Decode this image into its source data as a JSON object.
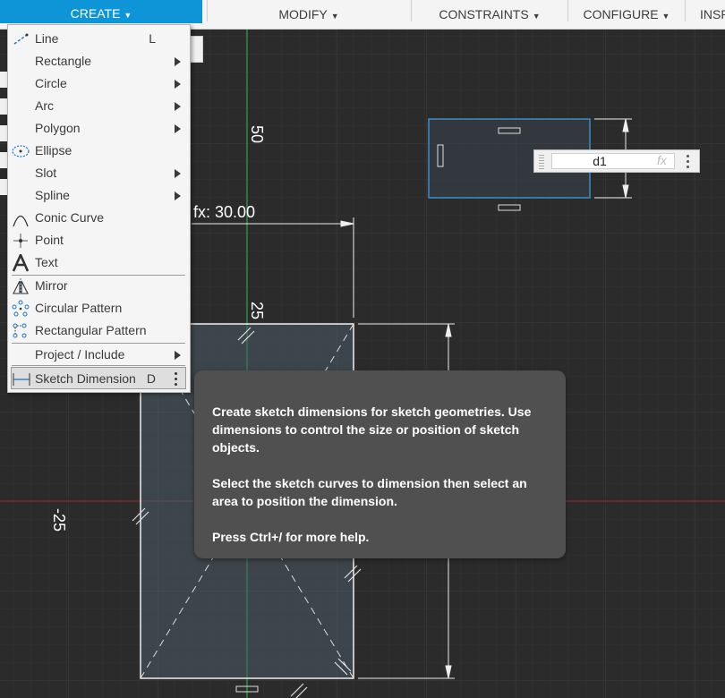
{
  "toolbar": {
    "create": "CREATE",
    "modify": "MODIFY",
    "constraints": "CONSTRAINTS",
    "configure": "CONFIGURE",
    "inspect": "INSPE"
  },
  "menu": {
    "items": [
      {
        "label": "Line",
        "shortcut": "L",
        "icon": "line-icon"
      },
      {
        "label": "Rectangle",
        "submenu": true
      },
      {
        "label": "Circle",
        "submenu": true
      },
      {
        "label": "Arc",
        "submenu": true
      },
      {
        "label": "Polygon",
        "submenu": true
      },
      {
        "label": "Ellipse",
        "icon": "ellipse-icon"
      },
      {
        "label": "Slot",
        "submenu": true
      },
      {
        "label": "Spline",
        "submenu": true
      },
      {
        "label": "Conic Curve",
        "icon": "conic-curve-icon"
      },
      {
        "label": "Point",
        "icon": "point-icon"
      },
      {
        "label": "Text",
        "icon": "text-icon"
      },
      {
        "label": "Mirror",
        "icon": "mirror-icon"
      },
      {
        "label": "Circular Pattern",
        "icon": "circular-pattern-icon"
      },
      {
        "label": "Rectangular Pattern",
        "icon": "rectangular-pattern-icon"
      },
      {
        "label": "Project / Include",
        "submenu": true
      },
      {
        "label": "Sketch Dimension",
        "shortcut": "D",
        "icon": "sketch-dimension-icon"
      }
    ]
  },
  "tooltip": {
    "para1": "Create sketch dimensions for sketch geometries. Use dimensions to control the size or position of sketch objects.",
    "para2": "Select the sketch curves to dimension then select an area to position the dimension.",
    "para3": "Press Ctrl+/ for more help."
  },
  "dimension_input": {
    "value": "d1",
    "fx": "fx"
  },
  "canvas_labels": {
    "fx_dim": "fx: 30.00",
    "ruler_50": "50",
    "ruler_25": "25",
    "ruler_neg25": "-25"
  },
  "colors": {
    "accent": "#0d95d7",
    "canvas": "#2b2b2b",
    "grid": "#363636",
    "y_axis": "#2ea24a",
    "x_axis": "#8a2a2a",
    "selection": "#3b8fc4"
  }
}
